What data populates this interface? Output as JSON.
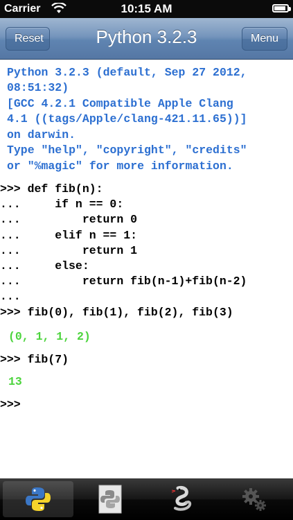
{
  "status_bar": {
    "carrier": "Carrier",
    "time": "10:15 AM",
    "battery_level": 0.9
  },
  "nav": {
    "title": "Python 3.2.3",
    "reset_label": "Reset",
    "menu_label": "Menu"
  },
  "console": {
    "banner": [
      "Python 3.2.3 (default, Sep 27 2012,",
      "08:51:32)",
      "[GCC 4.2.1 Compatible Apple Clang",
      "4.1 ((tags/Apple/clang-421.11.65))]",
      "on darwin.",
      "Type \"help\", \"copyright\", \"credits\"",
      "or \"%magic\" for more information."
    ],
    "code": [
      ">>> def fib(n):",
      "...     if n == 0:",
      "...         return 0",
      "...     elif n == 1:",
      "...         return 1",
      "...     else:",
      "...         return fib(n-1)+fib(n-2)",
      "...",
      ">>> fib(0), fib(1), fib(2), fib(3)"
    ],
    "output1": "(0, 1, 1, 2)",
    "input2": ">>> fib(7)",
    "output2": "13",
    "prompt": ">>>"
  },
  "colors": {
    "banner": "#2c6fd1",
    "output": "#4cd43d",
    "navbar": "#6b8db8"
  },
  "tabs": [
    {
      "icon": "python-logo-icon",
      "selected": true
    },
    {
      "icon": "script-document-icon",
      "selected": false
    },
    {
      "icon": "snake-help-icon",
      "selected": false
    },
    {
      "icon": "gears-settings-icon",
      "selected": false
    }
  ]
}
